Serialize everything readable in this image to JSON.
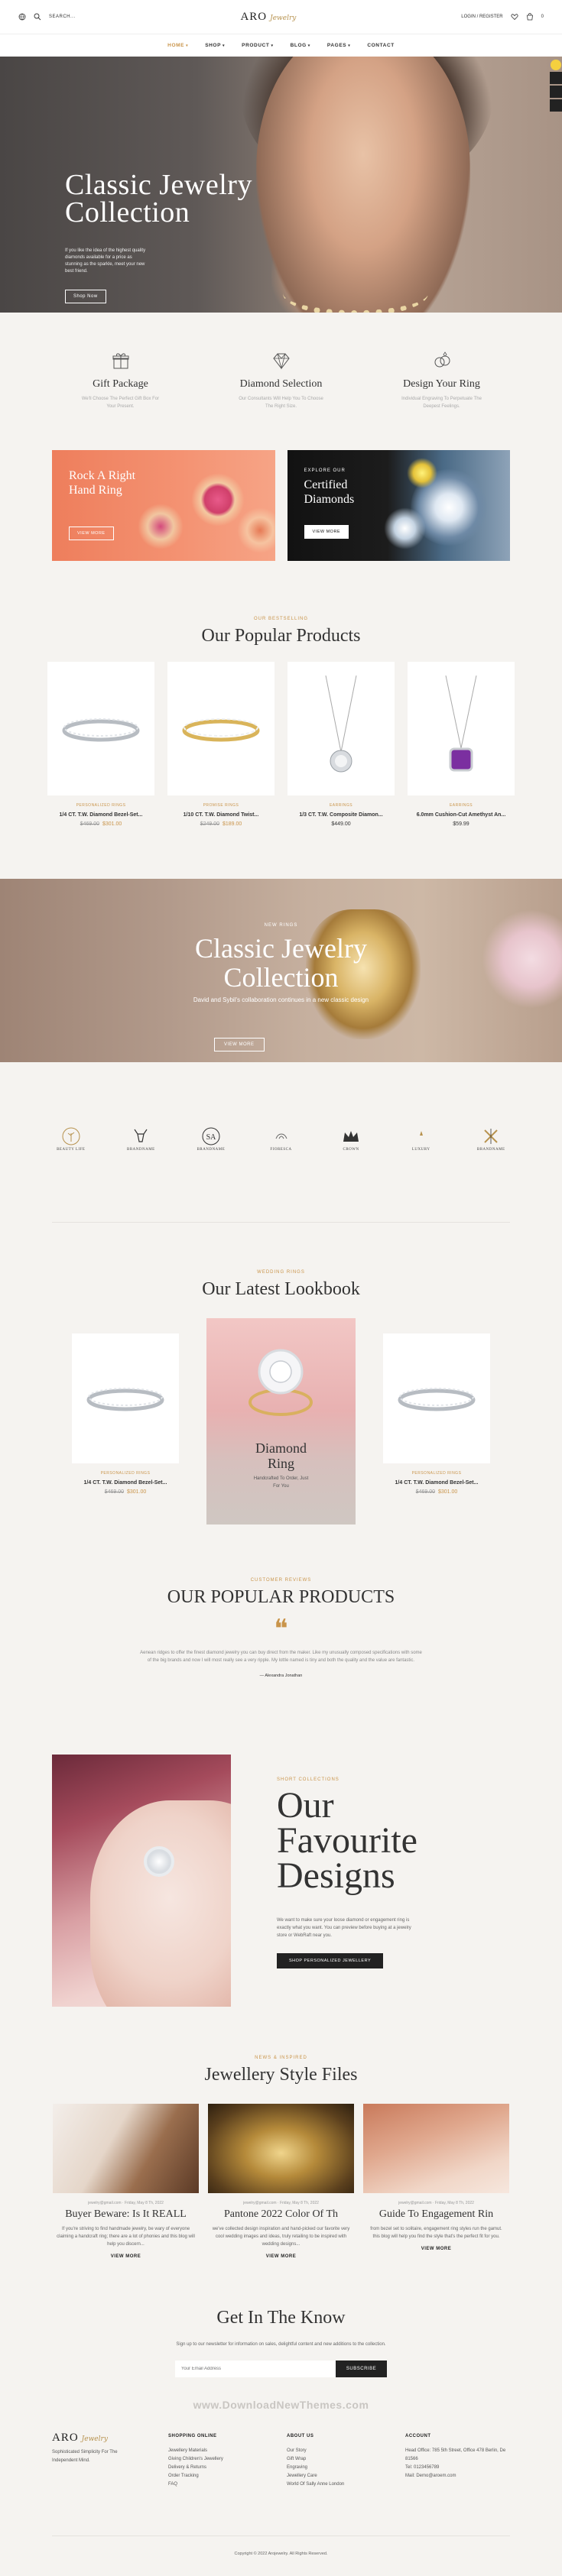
{
  "header": {
    "search_label": "SEARCH...",
    "logo_brand": "ARO",
    "logo_script": "Jewelry",
    "login_label": "LOGIN / REGISTER",
    "cart_count": "0"
  },
  "nav": [
    {
      "label": "HOME",
      "caret": true
    },
    {
      "label": "SHOP",
      "caret": true
    },
    {
      "label": "PRODUCT",
      "caret": true
    },
    {
      "label": "BLOG",
      "caret": true
    },
    {
      "label": "PAGES",
      "caret": true
    },
    {
      "label": "CONTACT",
      "caret": false
    }
  ],
  "hero": {
    "title_line1": "Classic Jewelry",
    "title_line2": "Collection",
    "text": "If you like the idea of the highest quality diamonds available for a price as stunning as the sparkle, meet your new best friend.",
    "button": "Shop Now"
  },
  "features": [
    {
      "icon": "gift-icon",
      "title": "Gift Package",
      "text": "We'll Choose The Perfect Gift Box For Your Present."
    },
    {
      "icon": "diamond-icon",
      "title": "Diamond Selection",
      "text": "Our Consultants Will Help You To Choose The Right Size."
    },
    {
      "icon": "rings-icon",
      "title": "Design Your Ring",
      "text": "Individual Engraving To Perpetuate The Deepest Feelings."
    }
  ],
  "promos": [
    {
      "sub": "",
      "title_line1": "Rock A Right",
      "title_line2": "Hand Ring",
      "button": "VIEW MORE"
    },
    {
      "sub": "EXPLORE OUR",
      "title_line1": "Certified",
      "title_line2": "Diamonds",
      "button": "VIEW MORE"
    }
  ],
  "popular": {
    "eyebrow": "OUR BESTSELLING",
    "title": "Our Popular Products",
    "items": [
      {
        "category": "PERSONALIZED RINGS",
        "name": "1/4 CT. T.W. Diamond Bezel-Set...",
        "old": "$469.00",
        "price": "$301.00",
        "sale": true
      },
      {
        "category": "PROMISE RINGS",
        "name": "1/10 CT. T.W. Diamond Twist...",
        "old": "$249.00",
        "price": "$189.00",
        "sale": true
      },
      {
        "category": "EARRINGS",
        "name": "1/3 CT. T.W. Composite Diamon...",
        "old": "",
        "price": "$449.00",
        "sale": false
      },
      {
        "category": "EARRINGS",
        "name": "6.0mm Cushion-Cut Amethyst An...",
        "old": "",
        "price": "$59.99",
        "sale": false
      }
    ]
  },
  "bigbanner": {
    "tag": "NEW RINGS",
    "title_line1": "Classic Jewelry",
    "title_line2": "Collection",
    "text": "David and Sybil's collaboration continues in a new classic design",
    "button": "VIEW MORE"
  },
  "brands": [
    {
      "icon": "tree-logo-icon",
      "name": "BEAUTY LIFE"
    },
    {
      "icon": "deer-logo-icon",
      "name": "BRANDNAME"
    },
    {
      "icon": "sa-logo-icon",
      "name": "BRANDNAME"
    },
    {
      "icon": "flourish-logo-icon",
      "name": "FIORESCA"
    },
    {
      "icon": "crown-logo-icon",
      "name": "CROWN"
    },
    {
      "icon": "luxury-logo-icon",
      "name": "LUXURY"
    },
    {
      "icon": "x-logo-icon",
      "name": "BRANDNAME"
    }
  ],
  "lookbook": {
    "eyebrow": "WEDDING RINGS",
    "title": "Our Latest Lookbook",
    "center_title_line1": "Diamond",
    "center_title_line2": "Ring",
    "center_text": "Handcrafted To Order, Just For You",
    "items": [
      {
        "category": "PERSONALIZED RINGS",
        "name": "1/4 CT. T.W. Diamond Bezel-Set...",
        "old": "$469.00",
        "price": "$301.00"
      },
      {
        "category": "PERSONALIZED RINGS",
        "name": "1/4 CT. T.W. Diamond Bezel-Set...",
        "old": "$469.00",
        "price": "$301.00"
      }
    ]
  },
  "testimonial": {
    "eyebrow": "CUSTOMER REVIEWS",
    "title": "OUR POPULAR PRODUCTS",
    "text": "Aenean ridges to offer the finest diamond jewelry you can buy direct from the maker. Like my unusually composed specifications with some of the big brands and now I will most really see a very ripple. My lottle named is tiny and both the quality and the value are fantastic.",
    "author": "— Alexandra Jonathan"
  },
  "favourite": {
    "eyebrow": "SHORT COLLECTIONS",
    "title_line1": "Our",
    "title_line2": "Favourite",
    "title_line3": "Designs",
    "text": "We want to make sure your loose diamond or engagement ring is exactly what you want. You can preview before buying at a jewelry store or WebRaft near you.",
    "button": "SHOP PERSONALIZED JEWELLERY"
  },
  "blog": {
    "eyebrow": "NEWS & INSPIRED",
    "title": "Jewellery Style Files",
    "posts": [
      {
        "meta": "jewelry@gmail.com · Friday, May 8 Th, 2022",
        "title": "Buyer Beware: Is It REALL",
        "text": "If you're striving to find handmade jewelry, be wary of everyone claiming a handcraft ring; there are a lot of phonies and this blog will help you discern...",
        "button": "VIEW MORE"
      },
      {
        "meta": "jewelry@gmail.com · Friday, May 8 Th, 2022",
        "title": "Pantone 2022 Color Of Th",
        "text": "we've collected design inspiration and hand-picked our favorite very cool wedding images and ideas, truly retailing to be inspired with wedding designs...",
        "button": "VIEW MORE"
      },
      {
        "meta": "jewelry@gmail.com · Friday, May 8 Th, 2022",
        "title": "Guide To Engagement Rin",
        "text": "from bezel set to solitaire, engagement ring styles run the gamut. this blog will help you find the style that's the perfect fit for you.",
        "button": "VIEW MORE"
      }
    ]
  },
  "newsletter": {
    "title": "Get In The Know",
    "text": "Sign up to our newsletter for information on sales, delightful content and new additions to the collection.",
    "placeholder": "Your Email Address",
    "button": "SUBSCRIBE"
  },
  "watermark": "www.DownloadNewThemes.com",
  "footer": {
    "about": "Sophisticated Simplicity For The Independent Mind.",
    "cols": [
      {
        "title": "SHOPPING ONLINE",
        "items": [
          "Jewellery Materials",
          "Giving Children's Jewellery",
          "Delivery & Returns",
          "Order Tracking",
          "FAQ"
        ]
      },
      {
        "title": "ABOUT US",
        "items": [
          "Our Story",
          "Gift Wrap",
          "Engraving",
          "Jewellery Care",
          "World Of Sally Anne London"
        ]
      },
      {
        "title": "ACCOUNT",
        "items": [
          "Head Office: 785 5th Street, Office 478 Berlin, De 81566",
          "Tel: 0123456789",
          "Mail: Demo@aroem.com"
        ]
      }
    ],
    "copyright": "Copyright © 2022 Arojewelry. All Rights Reserved."
  }
}
